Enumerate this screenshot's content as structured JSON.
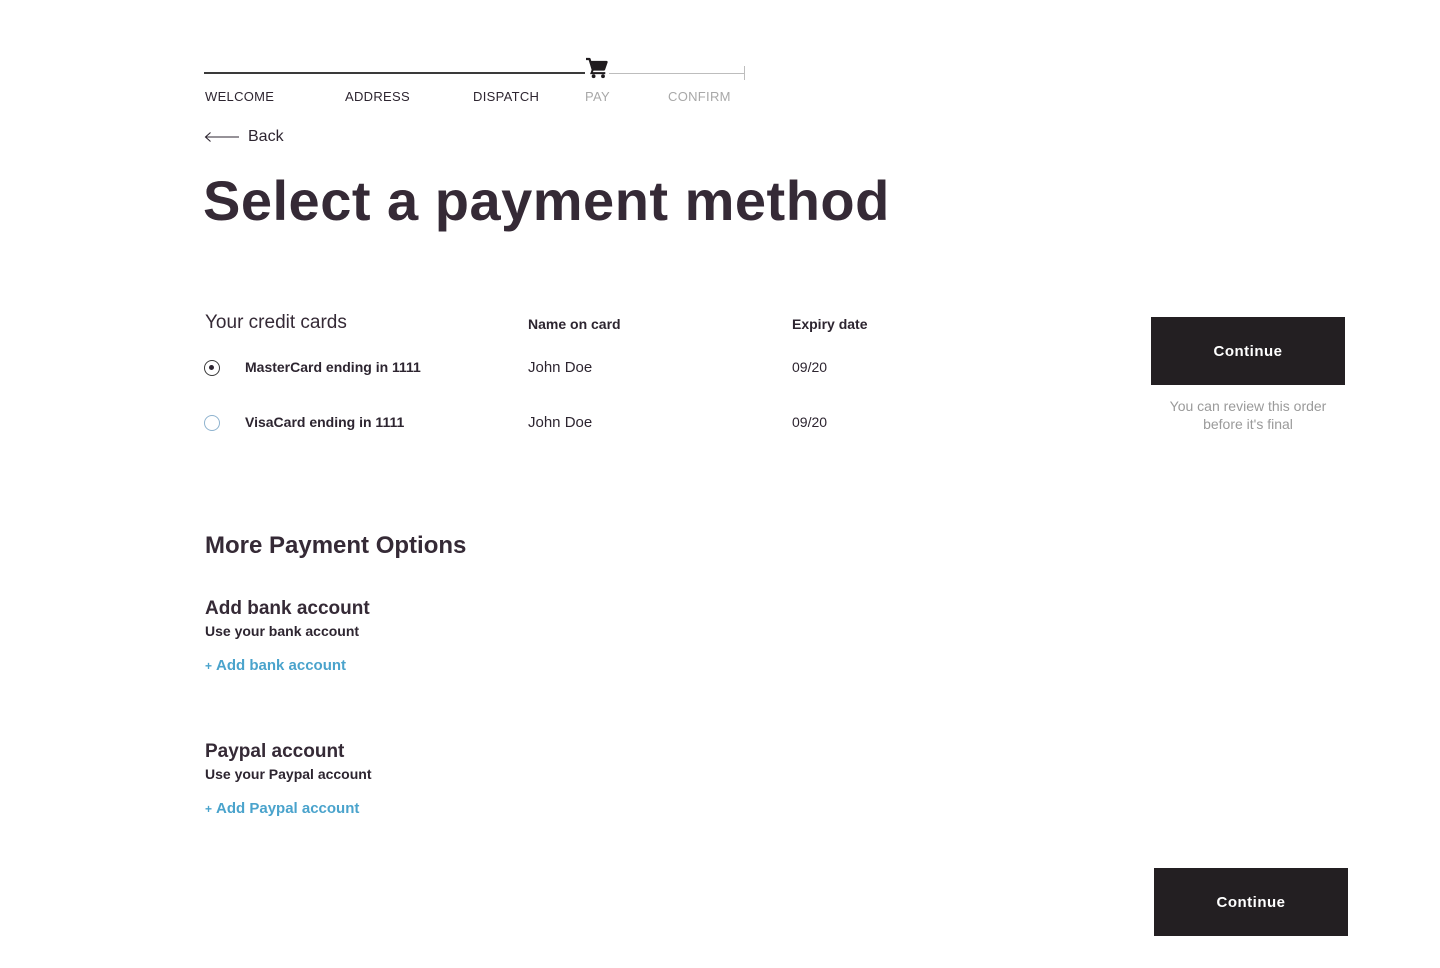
{
  "stepper": {
    "steps": [
      {
        "label": "WELCOME",
        "state": "done"
      },
      {
        "label": "ADDRESS",
        "state": "done"
      },
      {
        "label": "DISPATCH",
        "state": "done"
      },
      {
        "label": "PAY",
        "state": "current"
      },
      {
        "label": "CONFIRM",
        "state": "todo"
      }
    ],
    "current_icon": "shopping-cart-icon"
  },
  "back": {
    "label": "Back",
    "icon": "arrow-left-icon"
  },
  "page_title": "Select a payment method",
  "credit_cards": {
    "heading": "Your credit cards",
    "columns": {
      "name": "Name on card",
      "expiry": "Expiry date"
    },
    "rows": [
      {
        "label": "MasterCard ending in 1111",
        "holder": "John Doe",
        "expiry": "09/20",
        "selected": true
      },
      {
        "label": "VisaCard ending in 1111",
        "holder": "John Doe",
        "expiry": "09/20",
        "selected": false
      }
    ]
  },
  "sidebar": {
    "continue_label": "Continue",
    "review_note": "You can review this order before it's final"
  },
  "more_options": {
    "heading": "More Payment Options",
    "options": [
      {
        "title": "Add bank account",
        "subtitle": "Use your bank account",
        "link": "Add bank account"
      },
      {
        "title": "Paypal account",
        "subtitle": "Use your Paypal account",
        "link": "Add Paypal account"
      }
    ],
    "link_icon": "plus-icon"
  },
  "footer": {
    "continue_label": "Continue"
  },
  "colors": {
    "text_dark": "#352a36",
    "button_bg": "#231f22",
    "link_blue": "#4aa3cc",
    "muted": "#9a9a9a"
  }
}
